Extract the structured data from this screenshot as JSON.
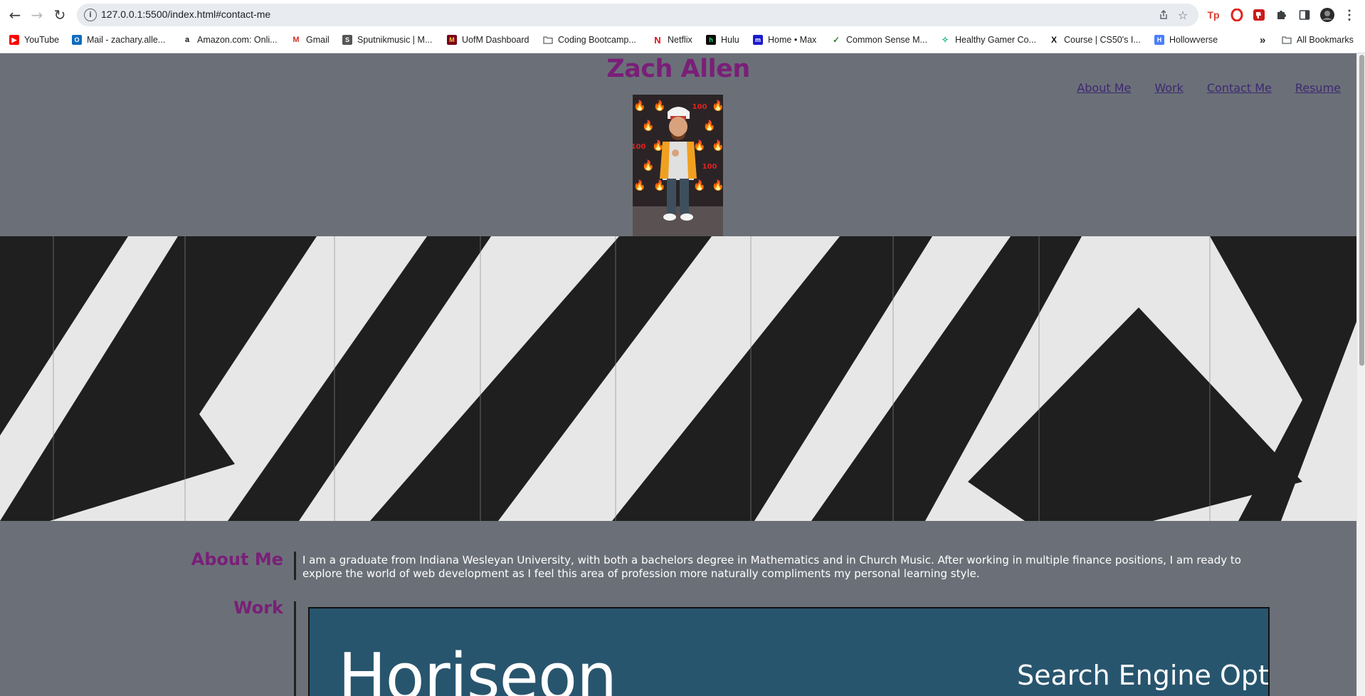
{
  "browser": {
    "url": "127.0.0.1:5500/index.html#contact-me",
    "bookmarks": [
      {
        "label": "YouTube",
        "icon": "youtube-icon"
      },
      {
        "label": "Mail - zachary.alle...",
        "icon": "outlook-icon"
      },
      {
        "label": "Amazon.com: Onli...",
        "icon": "amazon-icon"
      },
      {
        "label": "Gmail",
        "icon": "gmail-icon"
      },
      {
        "label": "Sputnikmusic | M...",
        "icon": "sputnik-icon"
      },
      {
        "label": "UofM Dashboard",
        "icon": "uofm-icon"
      },
      {
        "label": "Coding Bootcamp...",
        "icon": "folder-icon"
      },
      {
        "label": "Netflix",
        "icon": "netflix-icon"
      },
      {
        "label": "Hulu",
        "icon": "hulu-icon"
      },
      {
        "label": "Home • Max",
        "icon": "max-icon"
      },
      {
        "label": "Common Sense M...",
        "icon": "check-icon"
      },
      {
        "label": "Healthy Gamer Co...",
        "icon": "healthy-gamer-icon"
      },
      {
        "label": "Course | CS50's I...",
        "icon": "edx-icon"
      },
      {
        "label": "Hollowverse",
        "icon": "hollowverse-icon"
      }
    ],
    "overflow_label": "»",
    "all_bookmarks_label": "All Bookmarks"
  },
  "site": {
    "title": "Zach Allen",
    "nav": [
      "About Me",
      "Work",
      "Contact Me",
      "Resume"
    ],
    "about": {
      "heading": "About Me",
      "text": "I am a graduate from Indiana Wesleyan University, with both a bachelors degree in Mathematics and in Church Music. After working in multiple finance positions, I am ready to explore the world of web development as I feel this area of profession more naturally compliments my personal learning style."
    },
    "work": {
      "heading": "Work",
      "project_brand": "Horiseon",
      "project_tagline": "Search Engine Optimi"
    }
  },
  "colors": {
    "page_bg": "#6b7078",
    "heading": "#7a1f78",
    "nav_link": "#3d2872",
    "work_card": "#28556e"
  }
}
